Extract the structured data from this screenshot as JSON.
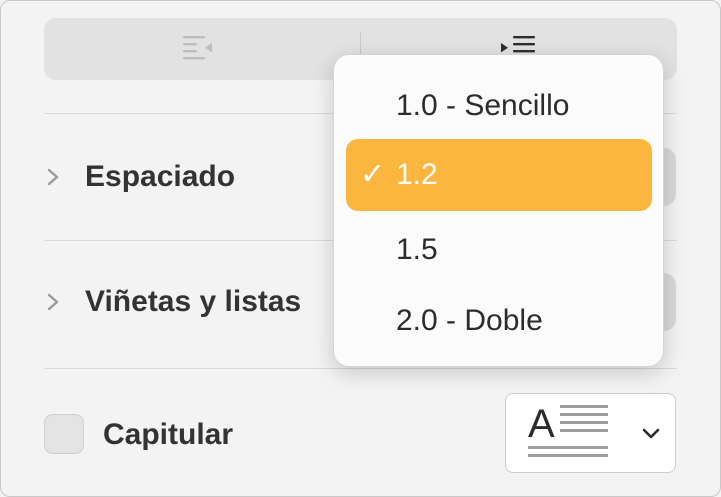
{
  "indentation": {
    "decrease_icon": "decrease-indent-icon",
    "increase_icon": "increase-indent-icon"
  },
  "sections": [
    {
      "label": "Espaciado",
      "icon": "chevron-right-icon"
    },
    {
      "label": "Viñetas y listas",
      "icon": "chevron-right-icon"
    }
  ],
  "drop_cap": {
    "label": "Capitular",
    "checked": false,
    "style_icon": "drop-cap-style-icon",
    "dropdown_icon": "chevron-down-icon"
  },
  "spacing_menu": {
    "items": [
      {
        "label": "1.0 - Sencillo",
        "selected": false
      },
      {
        "label": "1.2",
        "selected": true
      },
      {
        "label": "1.5",
        "selected": false
      },
      {
        "label": "2.0 - Doble",
        "selected": false
      }
    ],
    "check_glyph": "✓",
    "highlight_color": "#fbb63f"
  }
}
